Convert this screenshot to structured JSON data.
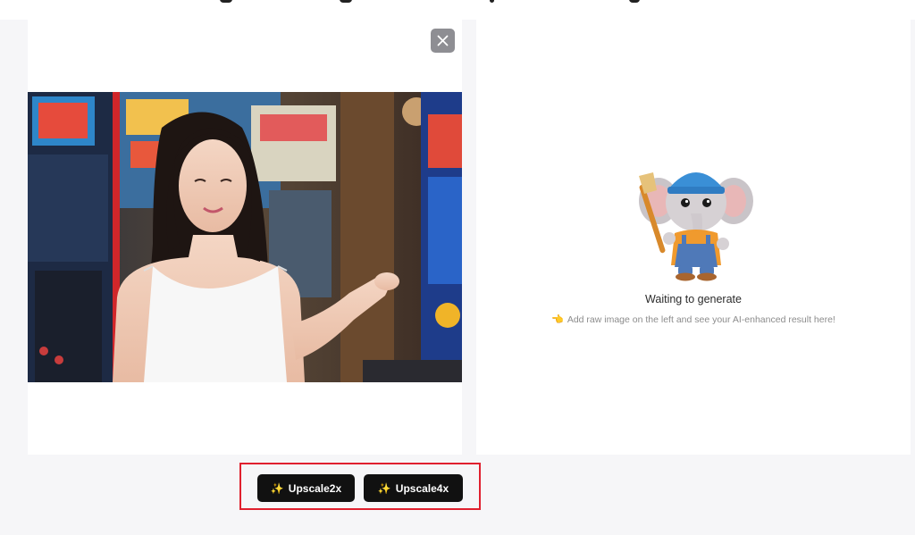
{
  "preview": {
    "close_icon": "close-icon",
    "image_alt": "raw uploaded image"
  },
  "result": {
    "title": "Waiting to generate",
    "hint_icon": "pointing-hand-icon",
    "hint": "Add raw image on the left and see your AI-enhanced result here!"
  },
  "actions": {
    "sparkle_icon": "sparkles-icon",
    "upscale2x_label": "Upscale2x",
    "upscale4x_label": "Upscale4x"
  },
  "colors": {
    "page_bg": "#f6f6f8",
    "button_bg": "#111111",
    "highlight": "#e0202e",
    "close_bg": "#8e8e93"
  }
}
